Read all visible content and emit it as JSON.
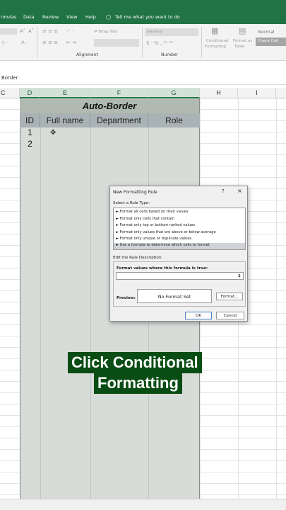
{
  "menu": {
    "items": [
      "rmulas",
      "Data",
      "Review",
      "View",
      "Help"
    ],
    "tell_me": "Tell me what you want to do"
  },
  "ribbon": {
    "wrap_text": "Wrap Text",
    "number_format": "General",
    "conditional_formatting_line1": "Conditional",
    "conditional_formatting_line2": "Formatting",
    "format_as_table_line1": "Format as",
    "format_as_table_line2": "Table",
    "style_normal": "Normal",
    "style_check_cell": "Check Cell",
    "group_alignment": "Alignment",
    "group_number": "Number"
  },
  "formula_bar": {
    "name_box": "Border"
  },
  "columns": [
    "C",
    "D",
    "E",
    "F",
    "G",
    "H",
    "I"
  ],
  "table": {
    "title": "Auto-Border",
    "headers": [
      "ID",
      "Full name",
      "Department",
      "Role"
    ],
    "ids": [
      "1",
      "2"
    ]
  },
  "dialog": {
    "title": "New Formatting Rule",
    "help": "?",
    "close": "×",
    "select_label": "Select a Rule Type:",
    "rules": [
      "► Format all cells based on their values",
      "► Format only cells that contain",
      "► Format only top or bottom ranked values",
      "► Format only values that are above or below average",
      "► Format only unique or duplicate values",
      "► Use a formula to determine which cells to format"
    ],
    "selected_rule_index": 5,
    "edit_label": "Edit the Rule Description:",
    "formula_label": "Format values where this formula is true:",
    "formula_value": "",
    "preview_label": "Preview:",
    "preview_text": "No Format Set",
    "format_button": "Format...",
    "ok_button": "OK",
    "cancel_button": "Cancel"
  },
  "caption": {
    "line1": "Click Conditional",
    "line2": "Formatting"
  },
  "colors": {
    "excel_green": "#217346",
    "caption_bg": "#0a4d14",
    "table_header_bg": "#a9b2b4",
    "table_title_bg": "#b1bab1"
  }
}
